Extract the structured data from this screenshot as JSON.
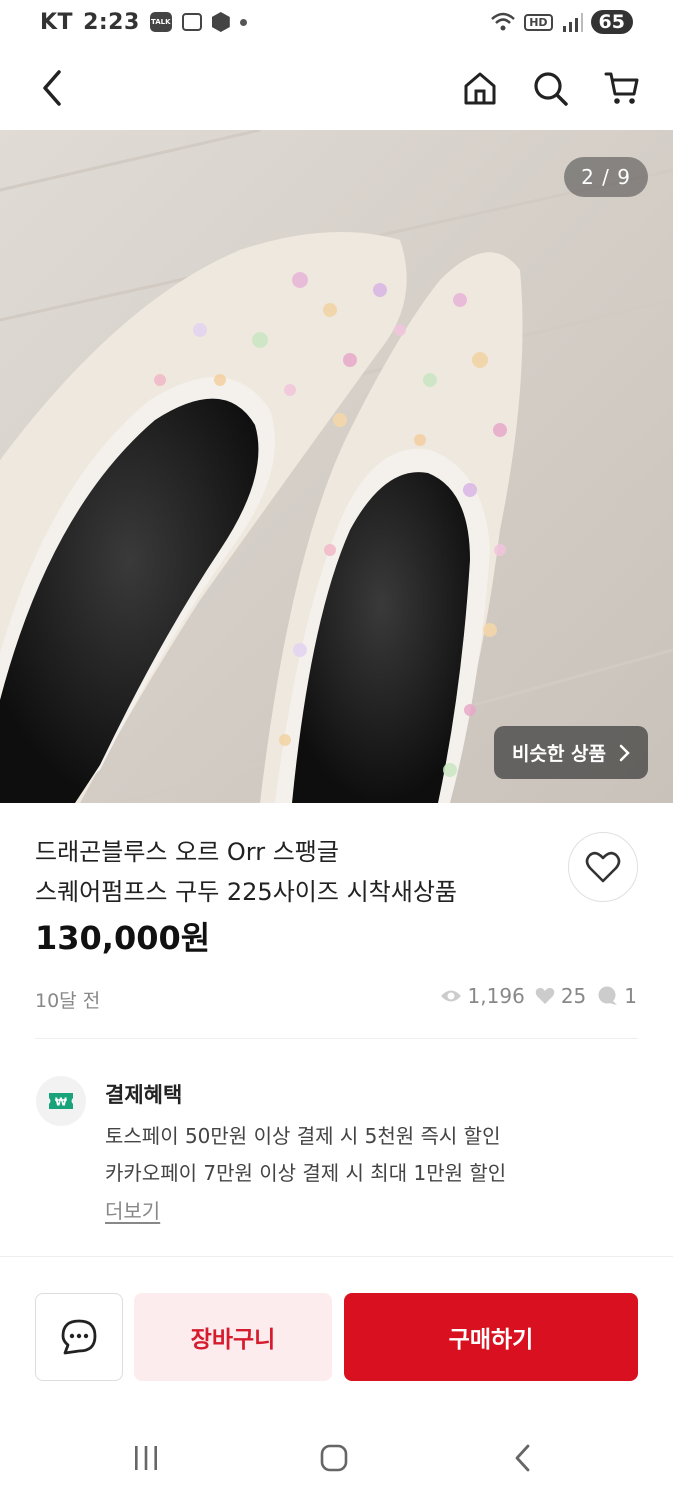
{
  "status_bar": {
    "carrier": "KT",
    "time": "2:23",
    "talk_badge": "TALK",
    "battery": "65"
  },
  "nav": {
    "icons": [
      "back-arrow-icon",
      "home-icon",
      "search-icon",
      "cart-icon"
    ]
  },
  "gallery": {
    "counter": "2 / 9",
    "similar_label": "비슷한 상품"
  },
  "product": {
    "title_line1": "드래곤블루스 오르 Orr 스팽글",
    "title_line2": "스퀘어펌프스 구두 225사이즈 시착새상품",
    "price": "130,000원",
    "posted": "10달 전",
    "views": "1,196",
    "likes": "25",
    "chats": "1"
  },
  "benefits": {
    "title": "결제혜택",
    "lines": [
      "토스페이 50만원 이상 결제 시 5천원 즉시 할인",
      "카카오페이 7만원 이상 결제 시 최대 1만원 할인"
    ],
    "more": "더보기",
    "icon_symbol": "₩"
  },
  "actions": {
    "cart": "장바구니",
    "buy": "구매하기"
  },
  "colors": {
    "accent": "#d9101f",
    "cart_bg": "#fdecee",
    "cart_text": "#d51b2d",
    "benefit_green": "#19a37a"
  }
}
